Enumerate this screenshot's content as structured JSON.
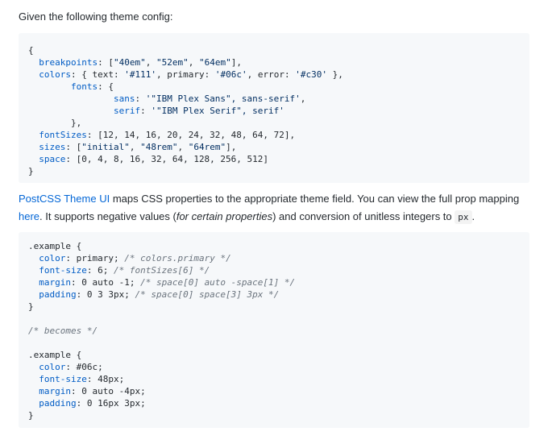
{
  "intro": "Given the following theme config:",
  "config_lines": [
    "{",
    "  breakpoints: [\"40em\", \"52em\", \"64em\"],",
    "  colors: { text: '#111', primary: '#06c', error: '#c30' },",
    "        fonts: {",
    "                sans: '\"IBM Plex Sans\", sans-serif',",
    "                serif: '\"IBM Plex Serif\", serif'",
    "        },",
    "  fontSizes: [12, 14, 16, 20, 24, 32, 48, 64, 72],",
    "  sizes: [\"initial\", \"48rem\", \"64rem\"],",
    "  space: [0, 4, 8, 16, 32, 64, 128, 256, 512]",
    "}"
  ],
  "description": {
    "link1": "PostCSS Theme UI",
    "text1": " maps CSS properties to the appropriate theme field. You can view the full prop mapping ",
    "link2": "here",
    "text2": ". It supports negative values (",
    "emphasis": "for certain properties",
    "text3": ") and conversion of unitless integers to ",
    "code": "px",
    "text4": "."
  },
  "example_lines": [
    ".example {",
    "  color: primary; /* colors.primary */",
    "  font-size: 6; /* fontSizes[6] */",
    "  margin: 0 auto -1; /* space[0] auto -space[1] */",
    "  padding: 0 3 3px; /* space[0] space[3] 3px */",
    "}",
    "",
    "/* becomes */",
    "",
    ".example {",
    "  color: #06c;",
    "  font-size: 48px;",
    "  margin: 0 auto -4px;",
    "  padding: 0 16px 3px;",
    "}"
  ]
}
